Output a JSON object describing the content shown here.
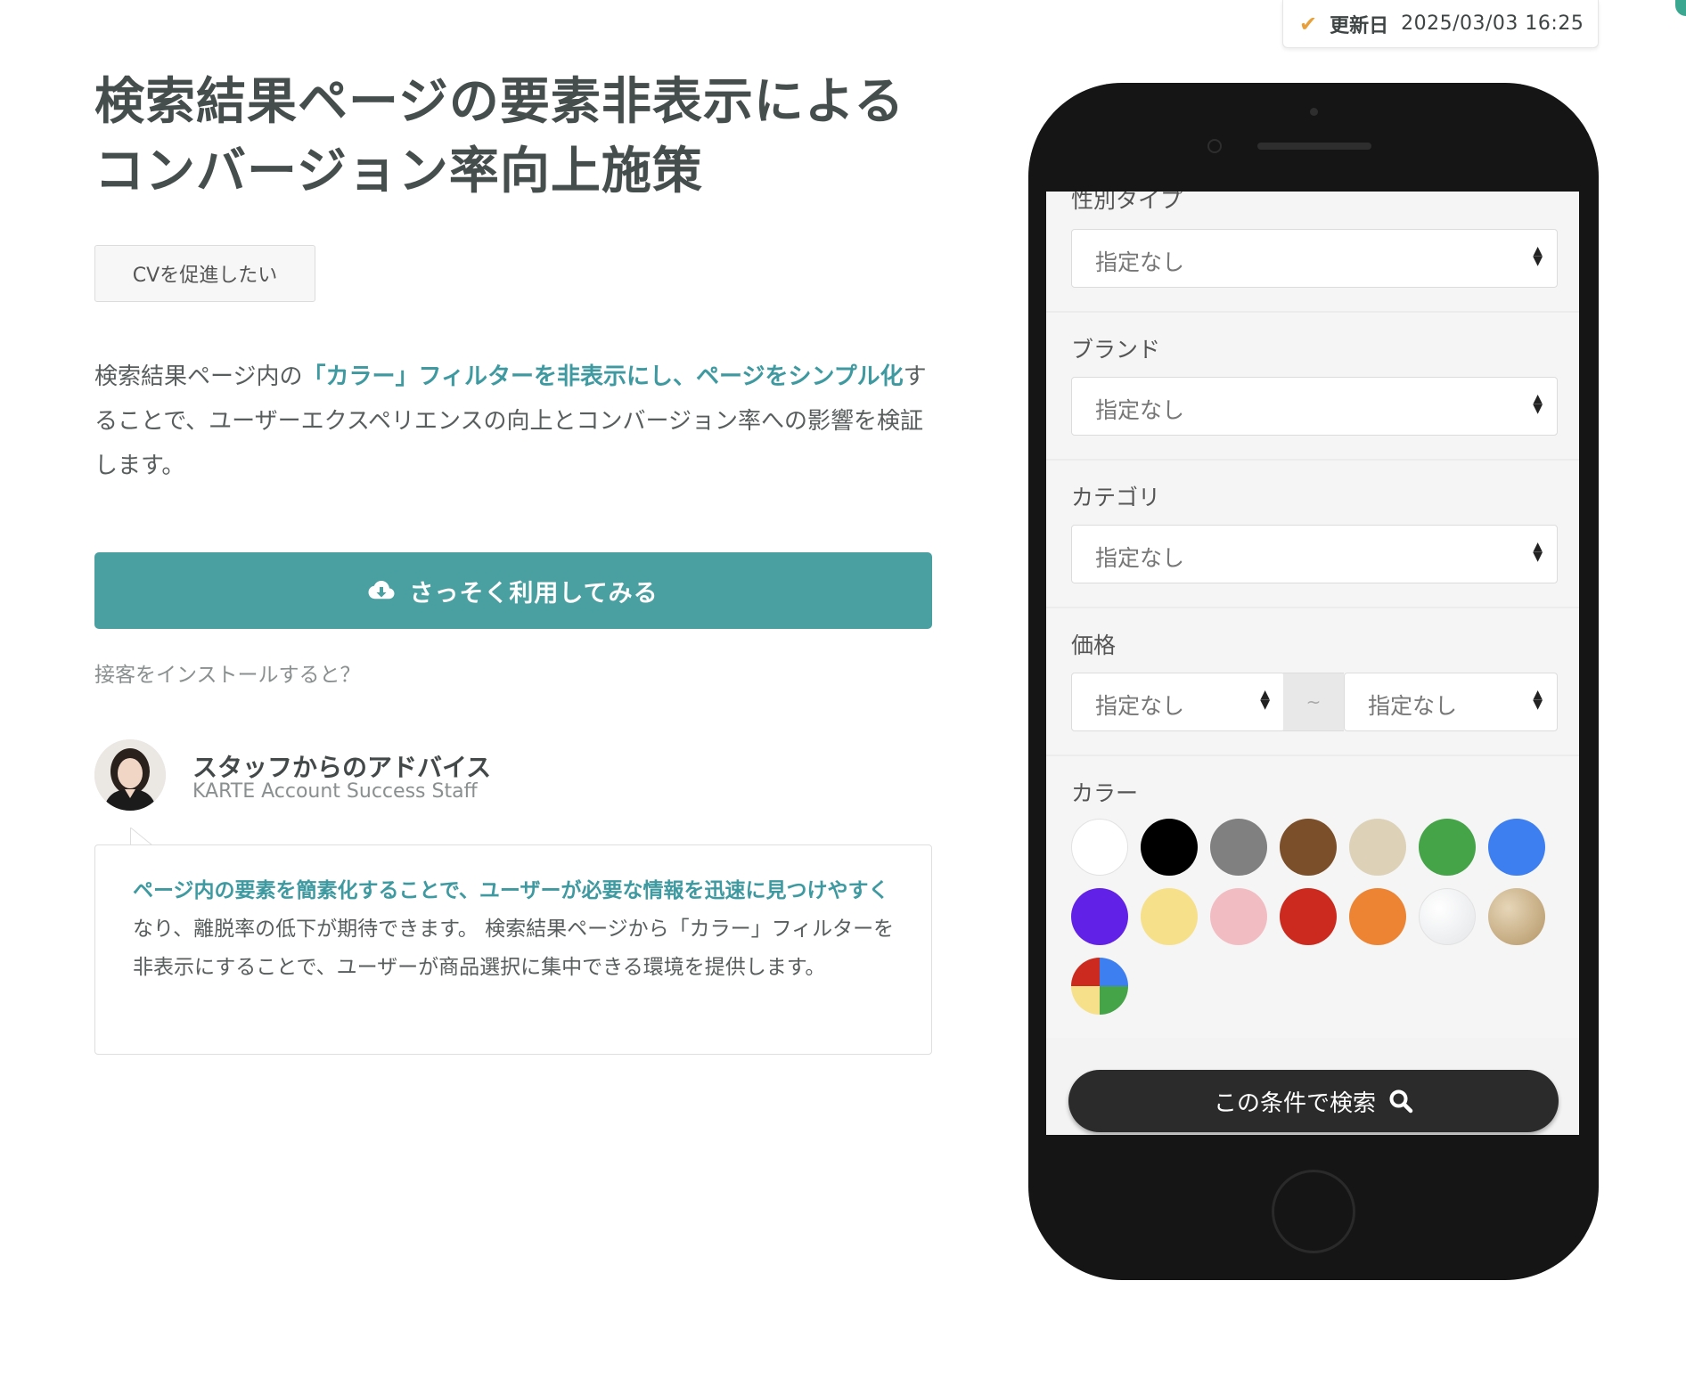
{
  "updated": {
    "label": "更新日",
    "date": "2025/03/03  16:25",
    "icon": "check-icon"
  },
  "title": {
    "line1": "検索結果ページの要素非表示による",
    "line2": "コンバージョン率向上施策"
  },
  "tag": "CVを促進したい",
  "description": {
    "text1": "検索結果ページ内の",
    "highlight": "「カラー」フィルターを非表示にし、ページをシンプル化",
    "text2": "することで、ユーザーエクスペリエンスの向上とコンバージョン率への影響を検証します。"
  },
  "cta": {
    "label": "さっそく利用してみる",
    "icon": "cloud-download-icon",
    "color": "#4a9fa1"
  },
  "install_link": "接客をインストールすると？",
  "advice": {
    "title": "スタッフからのアドバイス",
    "subtitle": "KARTE Account Success Staff",
    "highlight": "ページ内の要素を簡素化することで、ユーザーが必要な情報を迅速に見つけやすく",
    "text": "なり、離脱率の低下が期待できます。 検索結果ページから「カラー」フィルターを非表示にすることで、ユーザーが商品選択に集中できる環境を提供します。"
  },
  "phone": {
    "filters": [
      {
        "label": "性別タイプ",
        "value": "指定なし"
      },
      {
        "label": "ブランド",
        "value": "指定なし"
      },
      {
        "label": "カテゴリ",
        "value": "指定なし"
      }
    ],
    "price": {
      "label": "価格",
      "min": "指定なし",
      "separator": "~",
      "max": "指定なし"
    },
    "color_label": "カラー",
    "colors": [
      "#ffffff",
      "#000000",
      "#808080",
      "#7b4f2a",
      "#ddd2b8",
      "#45a348",
      "#3d7ef0",
      "#6221e6",
      "#f6e08a",
      "#f2bcc3",
      "#cc2a1e",
      "#ec8434",
      "#eeeff1",
      "#c9b08a",
      "multicolor"
    ],
    "search_button": "この条件で検索"
  }
}
